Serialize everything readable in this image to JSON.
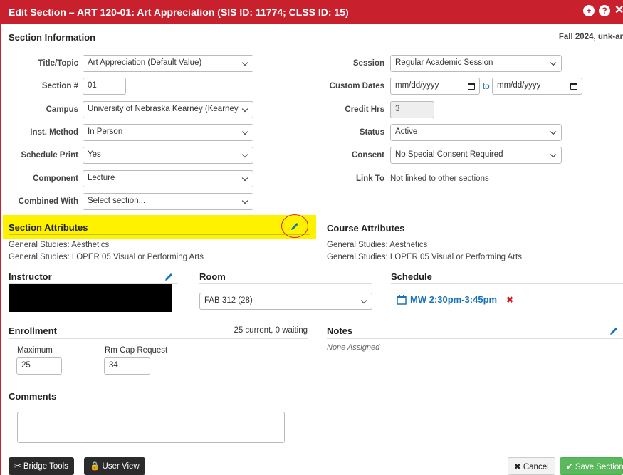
{
  "dialog": {
    "title": "Edit Section – ART 120-01: Art Appreciation (SIS ID: 11774; CLSS ID: 15)",
    "term": "Fall 2024, unk-ar"
  },
  "section_info": {
    "heading": "Section Information",
    "left_fields": [
      {
        "label": "Title/Topic",
        "value": "Art Appreciation (Default Value)"
      },
      {
        "label": "Section #",
        "value": "01"
      },
      {
        "label": "Campus",
        "value": "University of Nebraska Kearney (Kearney"
      },
      {
        "label": "Inst. Method",
        "value": "In Person"
      },
      {
        "label": "Schedule Print",
        "value": "Yes"
      },
      {
        "label": "Component",
        "value": "Lecture"
      },
      {
        "label": "Combined With",
        "value": "Select section..."
      }
    ],
    "right_fields": {
      "session": {
        "label": "Session",
        "value": "Regular Academic Session"
      },
      "custom_dates": {
        "label": "Custom Dates",
        "from": "mm/dd/yyyy",
        "to_label": "to",
        "to": "mm/dd/yyyy"
      },
      "credit_hrs": {
        "label": "Credit Hrs",
        "value": "3"
      },
      "status": {
        "label": "Status",
        "value": "Active"
      },
      "consent": {
        "label": "Consent",
        "value": "No Special Consent Required"
      },
      "link_to": {
        "label": "Link To",
        "value": "Not linked to other sections"
      }
    }
  },
  "section_attributes": {
    "heading": "Section Attributes",
    "items": [
      "General Studies: Aesthetics",
      "General Studies: LOPER 05 Visual or Performing Arts"
    ]
  },
  "course_attributes": {
    "heading": "Course Attributes",
    "items": [
      "General Studies: Aesthetics",
      "General Studies: LOPER 05 Visual or Performing Arts"
    ]
  },
  "instructor": {
    "heading": "Instructor"
  },
  "room": {
    "heading": "Room",
    "value": "FAB 312 (28)"
  },
  "schedule": {
    "heading": "Schedule",
    "meeting": "MW 2:30pm-3:45pm",
    "remove_icon": "✖"
  },
  "enrollment": {
    "heading": "Enrollment",
    "summary": "25 current, 0 waiting",
    "maximum_label": "Maximum",
    "maximum_value": "25",
    "rm_cap_label": "Rm Cap Request",
    "rm_cap_value": "34"
  },
  "notes": {
    "heading": "Notes",
    "value": "None Assigned"
  },
  "comments": {
    "heading": "Comments",
    "value": ""
  },
  "footer": {
    "bridge_tools": "Bridge Tools",
    "user_view": "User View",
    "cancel": "Cancel",
    "save": "Save Section"
  },
  "colors": {
    "title_bar": "#c9202e",
    "highlight": "#fff200",
    "annotation_circle": "#e0202a",
    "link": "#1a73b8",
    "save_button": "#5cb85c"
  }
}
